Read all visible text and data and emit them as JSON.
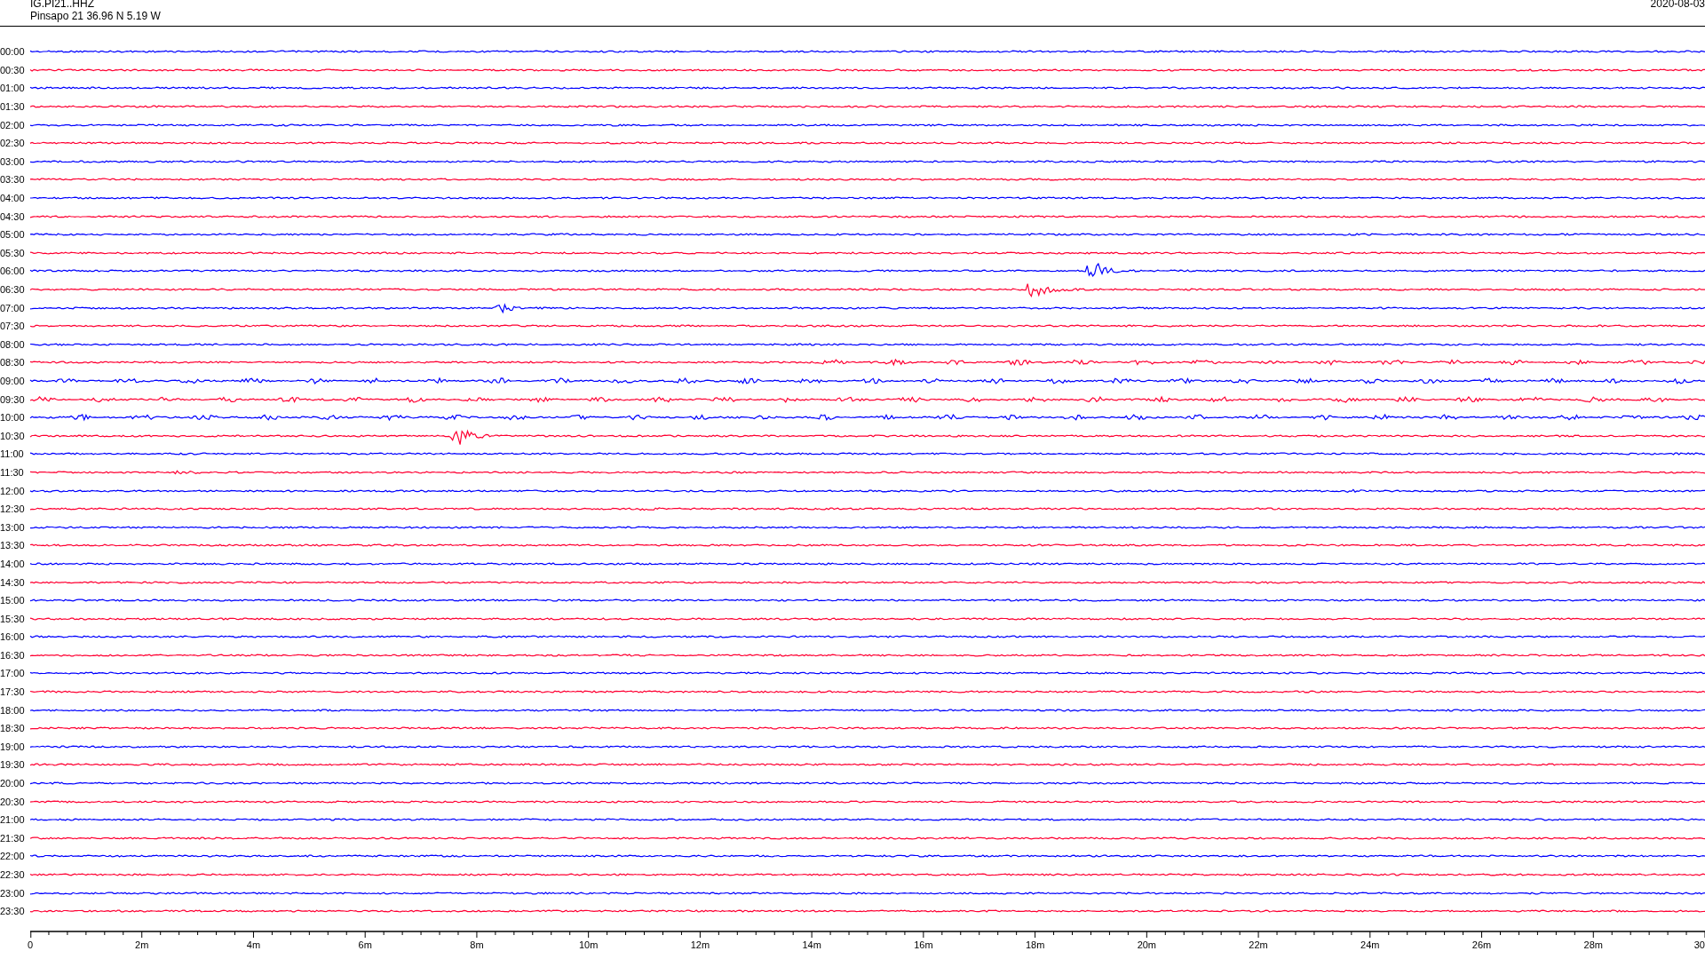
{
  "header": {
    "station": "IG.PI21..HHZ",
    "location": "Pinsapo 21  36.96 N 5.19 W",
    "date": "2020-08-03"
  },
  "rows": [
    {
      "label": "00:00",
      "color": "#0000ff"
    },
    {
      "label": "00:30",
      "color": "#ff0033"
    },
    {
      "label": "01:00",
      "color": "#0000ff"
    },
    {
      "label": "01:30",
      "color": "#ff0033"
    },
    {
      "label": "02:00",
      "color": "#0000ff"
    },
    {
      "label": "02:30",
      "color": "#ff0033"
    },
    {
      "label": "03:00",
      "color": "#0000ff"
    },
    {
      "label": "03:30",
      "color": "#ff0033"
    },
    {
      "label": "04:00",
      "color": "#0000ff"
    },
    {
      "label": "04:30",
      "color": "#ff0033"
    },
    {
      "label": "05:00",
      "color": "#0000ff"
    },
    {
      "label": "05:30",
      "color": "#ff0033"
    },
    {
      "label": "06:00",
      "color": "#0000ff"
    },
    {
      "label": "06:30",
      "color": "#ff0033"
    },
    {
      "label": "07:00",
      "color": "#0000ff"
    },
    {
      "label": "07:30",
      "color": "#ff0033"
    },
    {
      "label": "08:00",
      "color": "#0000ff"
    },
    {
      "label": "08:30",
      "color": "#ff0033"
    },
    {
      "label": "09:00",
      "color": "#0000ff"
    },
    {
      "label": "09:30",
      "color": "#ff0033"
    },
    {
      "label": "10:00",
      "color": "#0000ff"
    },
    {
      "label": "10:30",
      "color": "#ff0033"
    },
    {
      "label": "11:00",
      "color": "#0000ff"
    },
    {
      "label": "11:30",
      "color": "#ff0033"
    },
    {
      "label": "12:00",
      "color": "#0000ff"
    },
    {
      "label": "12:30",
      "color": "#ff0033"
    },
    {
      "label": "13:00",
      "color": "#0000ff"
    },
    {
      "label": "13:30",
      "color": "#ff0033"
    },
    {
      "label": "14:00",
      "color": "#0000ff"
    },
    {
      "label": "14:30",
      "color": "#ff0033"
    },
    {
      "label": "15:00",
      "color": "#0000ff"
    },
    {
      "label": "15:30",
      "color": "#ff0033"
    },
    {
      "label": "16:00",
      "color": "#0000ff"
    },
    {
      "label": "16:30",
      "color": "#ff0033"
    },
    {
      "label": "17:00",
      "color": "#0000ff"
    },
    {
      "label": "17:30",
      "color": "#ff0033"
    },
    {
      "label": "18:00",
      "color": "#0000ff"
    },
    {
      "label": "18:30",
      "color": "#ff0033"
    },
    {
      "label": "19:00",
      "color": "#0000ff"
    },
    {
      "label": "19:30",
      "color": "#ff0033"
    },
    {
      "label": "20:00",
      "color": "#0000ff"
    },
    {
      "label": "20:30",
      "color": "#ff0033"
    },
    {
      "label": "21:00",
      "color": "#0000ff"
    },
    {
      "label": "21:30",
      "color": "#ff0033"
    },
    {
      "label": "22:00",
      "color": "#0000ff"
    },
    {
      "label": "22:30",
      "color": "#ff0033"
    },
    {
      "label": "23:00",
      "color": "#0000ff"
    },
    {
      "label": "23:30",
      "color": "#ff0033"
    }
  ],
  "axis": {
    "ticks": [
      "0",
      "2m",
      "4m",
      "6m",
      "8m",
      "10m",
      "12m",
      "14m",
      "16m",
      "18m",
      "20m",
      "22m",
      "24m",
      "26m",
      "28m",
      "30"
    ]
  }
}
